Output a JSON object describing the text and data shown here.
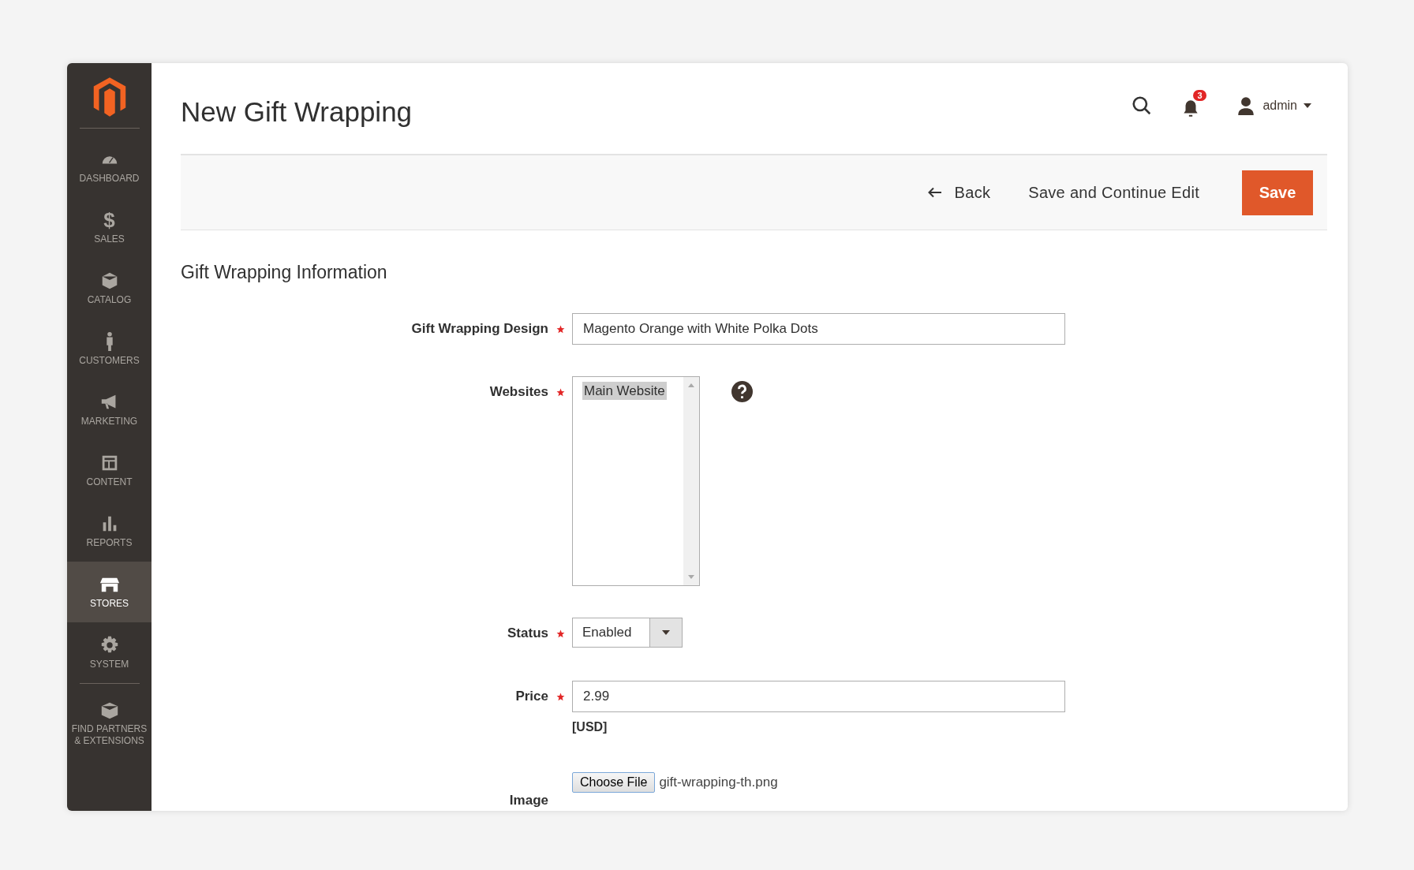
{
  "sidebar": {
    "items": [
      {
        "label": "DASHBOARD",
        "selected": false
      },
      {
        "label": "SALES",
        "selected": false,
        "glyph": "$"
      },
      {
        "label": "CATALOG",
        "selected": false
      },
      {
        "label": "CUSTOMERS",
        "selected": false
      },
      {
        "label": "MARKETING",
        "selected": false
      },
      {
        "label": "CONTENT",
        "selected": false
      },
      {
        "label": "REPORTS",
        "selected": false
      },
      {
        "label": "STORES",
        "selected": true
      },
      {
        "label": "SYSTEM",
        "selected": false
      },
      {
        "label": "FIND PARTNERS & EXTENSIONS",
        "selected": false
      }
    ]
  },
  "header": {
    "title": "New Gift Wrapping",
    "notification_count": "3",
    "user": "admin"
  },
  "actions": {
    "back": "Back",
    "save_continue": "Save and Continue Edit",
    "save": "Save"
  },
  "section": {
    "title": "Gift Wrapping Information"
  },
  "fields": [
    {
      "kind": "text",
      "label": "Gift Wrapping Design",
      "required": true,
      "value": "Magento Orange with White Polka Dots"
    },
    {
      "kind": "multiselect",
      "label": "Websites",
      "required": true,
      "options": [
        {
          "label": "Main Website",
          "selected": true
        }
      ]
    },
    {
      "kind": "select",
      "label": "Status",
      "required": true,
      "value": "Enabled"
    },
    {
      "kind": "text",
      "label": "Price",
      "required": true,
      "value": "2.99",
      "note": "[USD]"
    },
    {
      "kind": "file",
      "label": "Image",
      "required": false,
      "button": "Choose File",
      "value": "gift-wrapping-th.png"
    }
  ]
}
